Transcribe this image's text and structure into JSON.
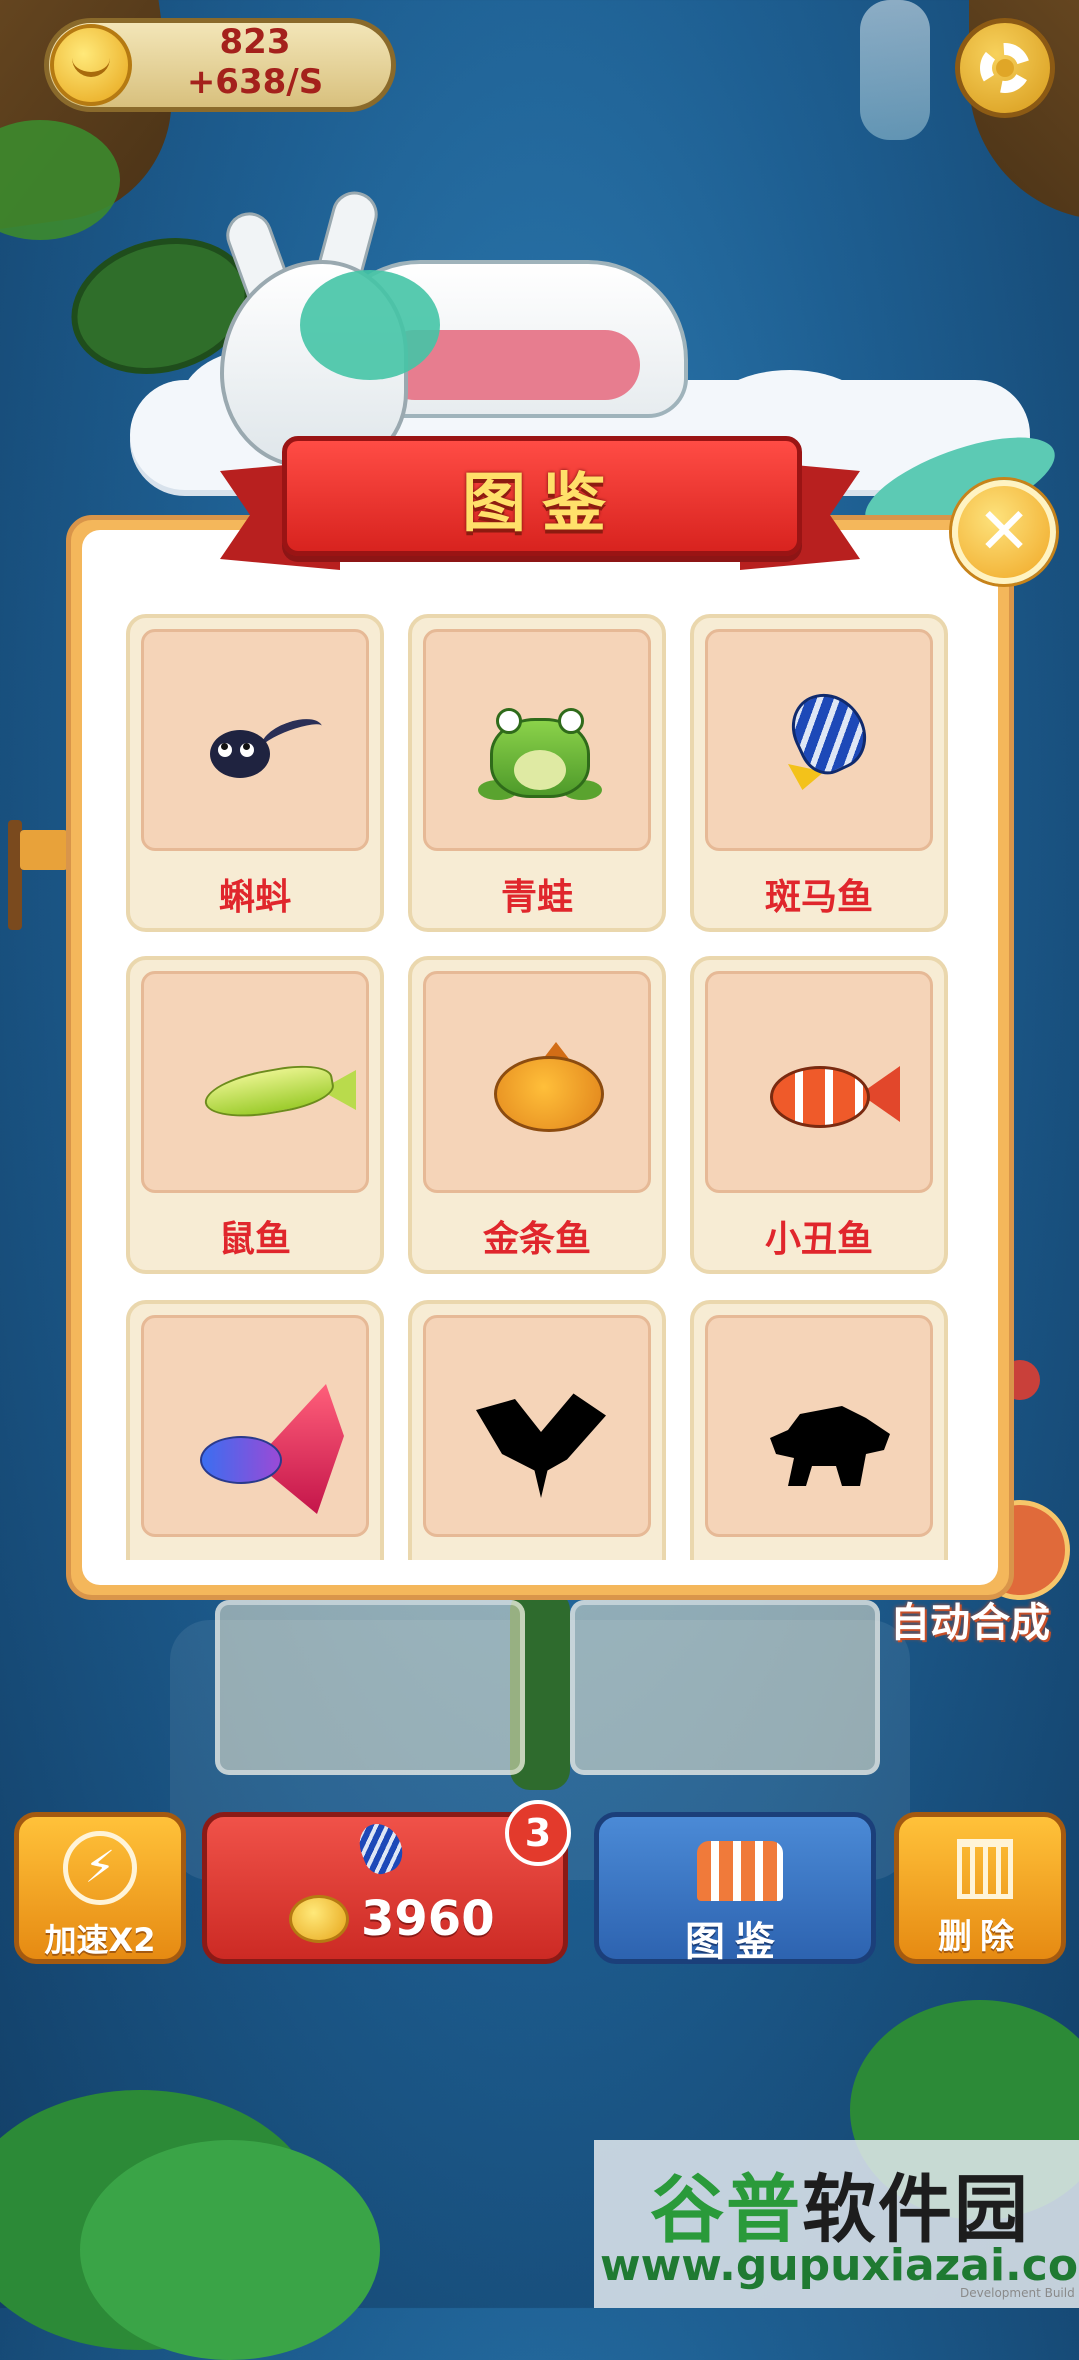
{
  "hud": {
    "coins": "823",
    "rate": "+638/S",
    "settings_icon": "gear-icon"
  },
  "dialog": {
    "title": "图鉴",
    "close_icon": "close-icon",
    "items": [
      {
        "label": "蝌蚪",
        "unlocked": true,
        "art": "tadpole"
      },
      {
        "label": "青蛙",
        "unlocked": true,
        "art": "frog"
      },
      {
        "label": "斑马鱼",
        "unlocked": true,
        "art": "zebrafish"
      },
      {
        "label": "鼠鱼",
        "unlocked": true,
        "art": "mouse-fish"
      },
      {
        "label": "金条鱼",
        "unlocked": true,
        "art": "golden-fish"
      },
      {
        "label": "小丑鱼",
        "unlocked": true,
        "art": "clownfish"
      },
      {
        "label": "",
        "unlocked": true,
        "art": "betta-fish"
      },
      {
        "label": "",
        "unlocked": false,
        "art": "manta-ray-silhouette"
      },
      {
        "label": "",
        "unlocked": false,
        "art": "turtle-silhouette"
      }
    ]
  },
  "background": {
    "auto_merge_label": "自动合成"
  },
  "bottom_bar": {
    "speed_label": "加速X2",
    "buy_price": "3960",
    "buy_badge": "3",
    "book_label": "图鉴",
    "delete_label": "删除"
  },
  "watermark": {
    "title_green": "谷普",
    "title_dark": "软件园",
    "url": "www.gupuxiazai.com",
    "dev_build": "Development Build"
  },
  "colors": {
    "accent_red": "#e0262c",
    "dialog_border": "#f4b75b",
    "card_bg": "#f7ecd4",
    "card_image_bg": "#f5d4b8"
  }
}
